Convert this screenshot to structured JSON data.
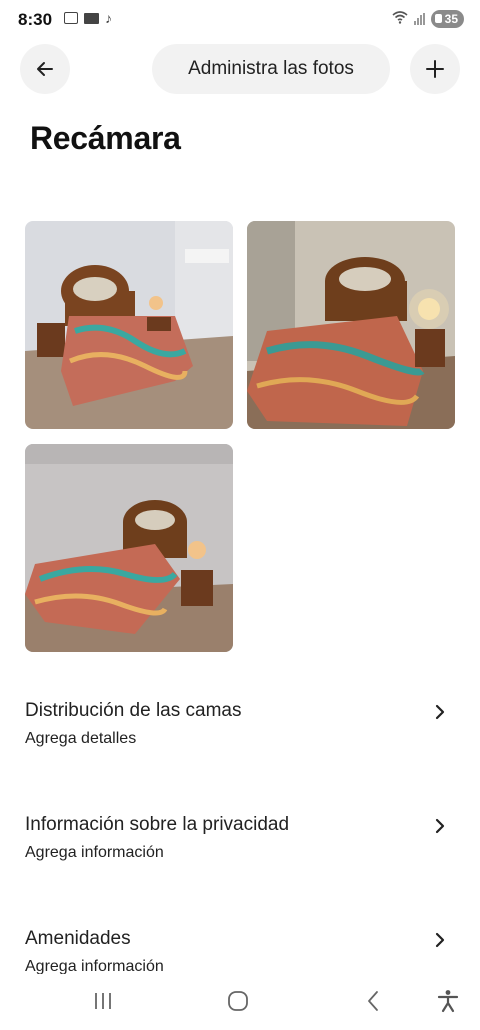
{
  "status_bar": {
    "time": "8:30",
    "battery": "35"
  },
  "header": {
    "title": "Administra las fotos"
  },
  "room": {
    "title": "Recámara"
  },
  "photos": [
    {
      "description": "bedroom-photo-1"
    },
    {
      "description": "bedroom-photo-2"
    },
    {
      "description": "bedroom-photo-3"
    }
  ],
  "sections": [
    {
      "title": "Distribución de las camas",
      "subtitle": "Agrega detalles"
    },
    {
      "title": "Información sobre la privacidad",
      "subtitle": "Agrega información"
    },
    {
      "title": "Amenidades",
      "subtitle": "Agrega información"
    }
  ],
  "colors": {
    "pill_bg": "#f2f2f2",
    "text": "#222222"
  },
  "icons": [
    "arrow-left-icon",
    "plus-icon",
    "chevron-right-icon",
    "recent-apps-icon",
    "home-icon",
    "back-icon",
    "accessibility-icon"
  ]
}
